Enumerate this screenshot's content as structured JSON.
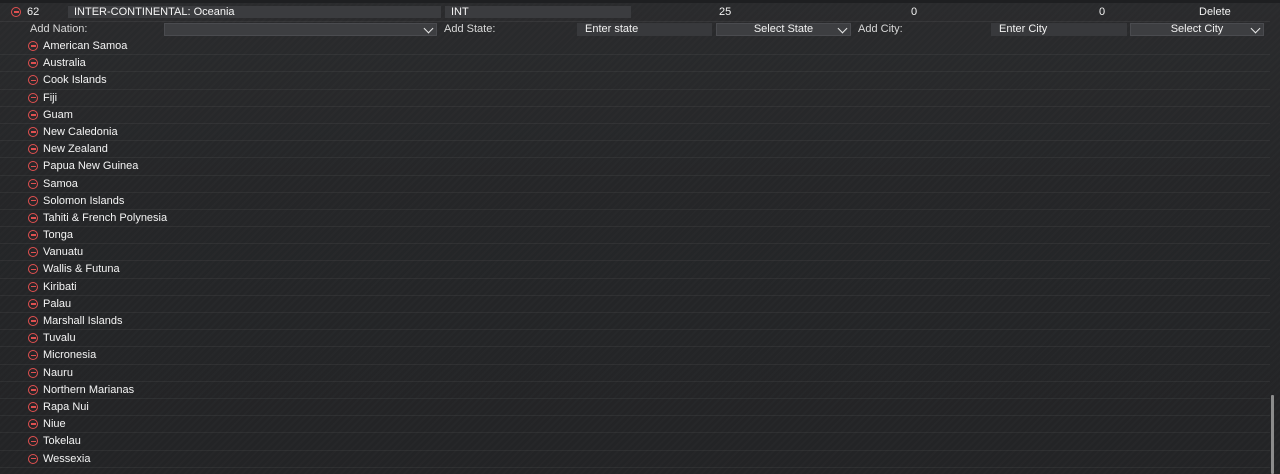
{
  "header": {
    "id": "62",
    "name": "INTER-CONTINENTAL: Oceania",
    "code": "INT",
    "count_a": "25",
    "count_b": "0",
    "count_c": "0",
    "delete_label": "Delete"
  },
  "add_row": {
    "nation_label": "Add Nation:",
    "nation_value": "",
    "state_label": "Add State:",
    "state_input_placeholder": "Enter state",
    "state_select_label": "Select State",
    "city_label": "Add City:",
    "city_input_placeholder": "Enter City",
    "city_select_label": "Select City"
  },
  "nations": [
    "American Samoa",
    "Australia",
    "Cook Islands",
    "Fiji",
    "Guam",
    "New Caledonia",
    "New Zealand",
    "Papua New Guinea",
    "Samoa",
    "Solomon Islands",
    "Tahiti & French Polynesia",
    "Tonga",
    "Vanuatu",
    "Wallis & Futuna",
    "Kiribati",
    "Palau",
    "Marshall Islands",
    "Tuvalu",
    "Micronesia",
    "Nauru",
    "Northern Marianas",
    "Rapa Nui",
    "Niue",
    "Tokelau",
    "Wessexia"
  ],
  "colors": {
    "remove_icon": "#e05050",
    "field_bg": "#3b3c3f",
    "page_bg": "#262729"
  }
}
